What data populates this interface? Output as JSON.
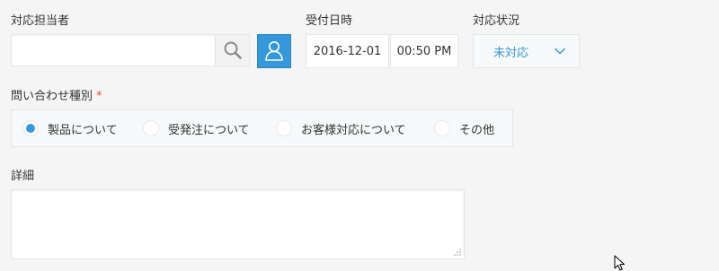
{
  "fields": {
    "assignee": {
      "label": "対応担当者",
      "value": "",
      "search_icon": "search-icon",
      "user_icon": "user-icon",
      "accent_color": "#3498db"
    },
    "received_datetime": {
      "label": "受付日時",
      "date": "2016-12-01",
      "time": "00:50 PM"
    },
    "status": {
      "label": "対応状況",
      "value": "未対応",
      "chevron_icon": "chevron-down-icon",
      "value_color": "#3498db"
    },
    "inquiry_type": {
      "label": "問い合わせ種別",
      "required_mark": "*",
      "required_color": "#e74c3c",
      "options": [
        {
          "label": "製品について",
          "checked": true
        },
        {
          "label": "受発注について",
          "checked": false
        },
        {
          "label": "お客様対応について",
          "checked": false
        },
        {
          "label": "その他",
          "checked": false
        }
      ]
    },
    "details": {
      "label": "詳細",
      "value": ""
    }
  }
}
